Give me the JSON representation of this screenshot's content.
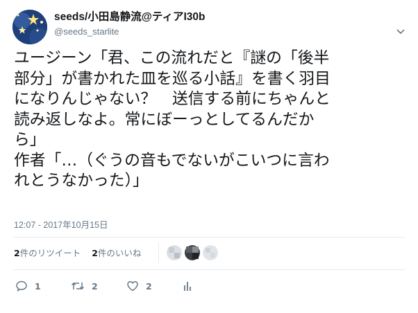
{
  "tweet": {
    "display_name": "seeds/小田島静流@ティアI30b",
    "handle": "@seeds_starlite",
    "text_lines": [
      "ユージーン「君、この流れだと『謎の「後半",
      "部分」が書かれた皿を巡る小話』を書く羽目",
      "になりんじゃない？　送信する前にちゃんと",
      "読み返しなよ。常にぼーっとしてるんだか",
      "ら」",
      "作者「…（ぐうの音もでないがこいつに言わ",
      "れとうなかった）」"
    ],
    "timestamp": "12:07 - 2017年10月15日"
  },
  "stats": {
    "retweets_count": "2",
    "retweets_label": "件のリツイート",
    "likes_count": "2",
    "likes_label": "件のいいね"
  },
  "actions": {
    "reply_count": "1",
    "retweet_count": "2",
    "like_count": "2"
  },
  "icons": {
    "caret": "chevron-down-icon",
    "reply": "reply-icon",
    "retweet": "retweet-icon",
    "like": "heart-icon",
    "analytics": "analytics-icon"
  },
  "colors": {
    "text": "#14171a",
    "muted": "#657786",
    "divider": "#e6ecf0"
  }
}
